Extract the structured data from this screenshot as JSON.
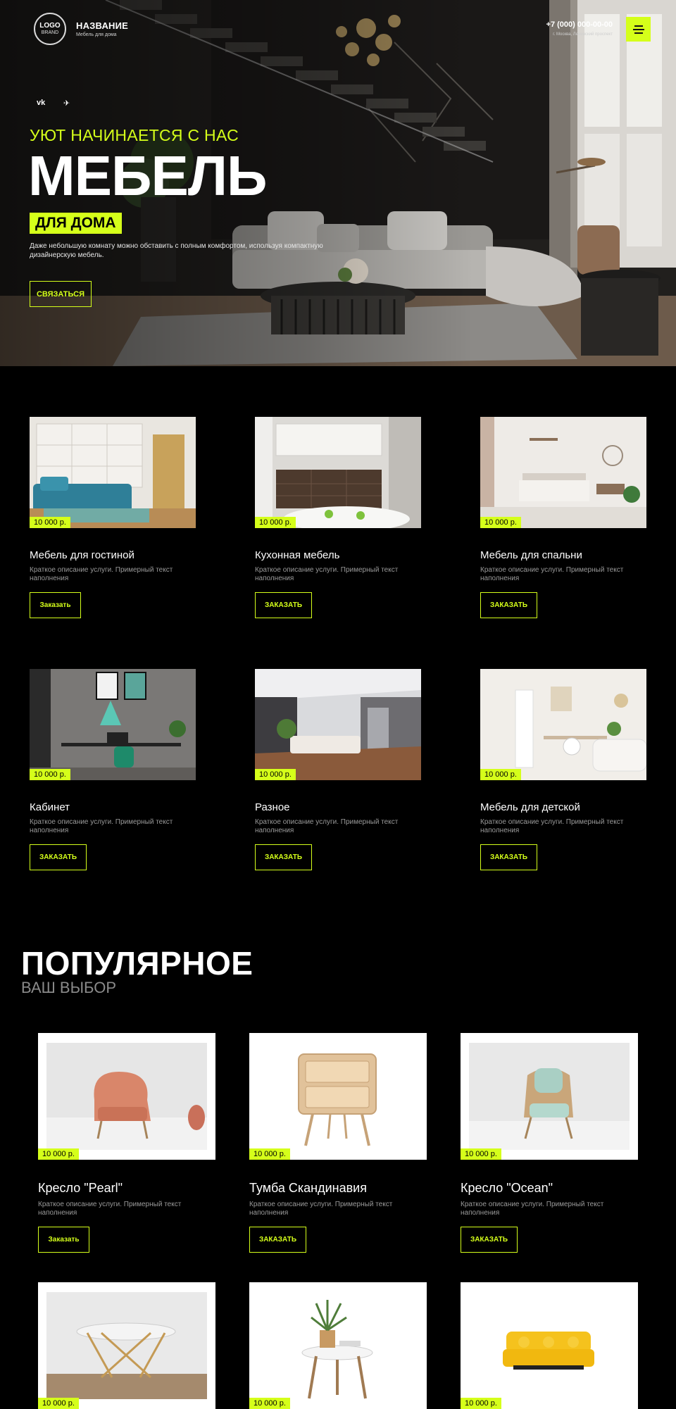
{
  "header": {
    "logo_line1": "LOGO",
    "logo_line2": "BRAND",
    "brand_name": "НАЗВАНИЕ",
    "brand_subtitle": "Мебель для дома",
    "phone": "+7 (000) 000-00-00",
    "address": "г. Москва, Ленинский проспект",
    "menu_icon": "hamburger-menu-icon"
  },
  "hero": {
    "social": [
      {
        "label": "vk",
        "icon": "vk-icon"
      },
      {
        "label": "✈",
        "icon": "telegram-icon"
      }
    ],
    "tagline": "УЮТ НАЧИНАЕТСЯ С НАС",
    "title": "МЕБЕЛЬ",
    "badge": "ДЛЯ ДОМА",
    "description": "Даже небольшую комнату можно обставить с полным комфортом, используя компактную дизайнерскую мебель.",
    "cta": "СВЯЗАТЬСЯ"
  },
  "categories": [
    {
      "title": "Мебель для гостиной",
      "price": "10 000 р.",
      "description": "Краткое описание услуги. Примерный текст наполнения",
      "button": "Заказать"
    },
    {
      "title": "Кухонная мебель",
      "price": "10 000 р.",
      "description": "Краткое описание услуги. Примерный текст наполнения",
      "button": "ЗАКАЗАТЬ"
    },
    {
      "title": "Мебель для спальни",
      "price": "10 000 р.",
      "description": "Краткое описание услуги. Примерный текст наполнения",
      "button": "ЗАКАЗАТЬ"
    },
    {
      "title": "Кабинет",
      "price": "10 000 р.",
      "description": "Краткое описание услуги. Примерный текст наполнения",
      "button": "ЗАКАЗАТЬ"
    },
    {
      "title": "Разное",
      "price": "10 000 р.",
      "description": "Краткое описание услуги. Примерный текст наполнения",
      "button": "ЗАКАЗАТЬ"
    },
    {
      "title": "Мебель для детской",
      "price": "10 000 р.",
      "description": "Краткое описание услуги. Примерный текст наполнения",
      "button": "ЗАКАЗАТЬ"
    }
  ],
  "popular": {
    "title": "ПОПУЛЯРНОЕ",
    "subtitle": "ВАШ ВЫБОР",
    "items": [
      {
        "title": "Кресло \"Pearl\"",
        "price": "10 000 р.",
        "description": "Краткое описание услуги. Примерный текст наполнения",
        "button": "Заказать"
      },
      {
        "title": "Тумба Скандинавия",
        "price": "10 000 р.",
        "description": "Краткое описание услуги. Примерный текст наполнения",
        "button": "ЗАКАЗАТЬ"
      },
      {
        "title": "Кресло \"Ocean\"",
        "price": "10 000 р.",
        "description": "Краткое описание услуги. Примерный текст наполнения",
        "button": "ЗАКАЗАТЬ"
      },
      {
        "title": "",
        "price": "10 000 р.",
        "description": "",
        "button": ""
      },
      {
        "title": "",
        "price": "10 000 р.",
        "description": "",
        "button": ""
      },
      {
        "title": "",
        "price": "10 000 р.",
        "description": "",
        "button": ""
      }
    ]
  },
  "colors": {
    "accent": "#d5ff1a",
    "background": "#000000",
    "muted_text": "#9a9a9a"
  }
}
